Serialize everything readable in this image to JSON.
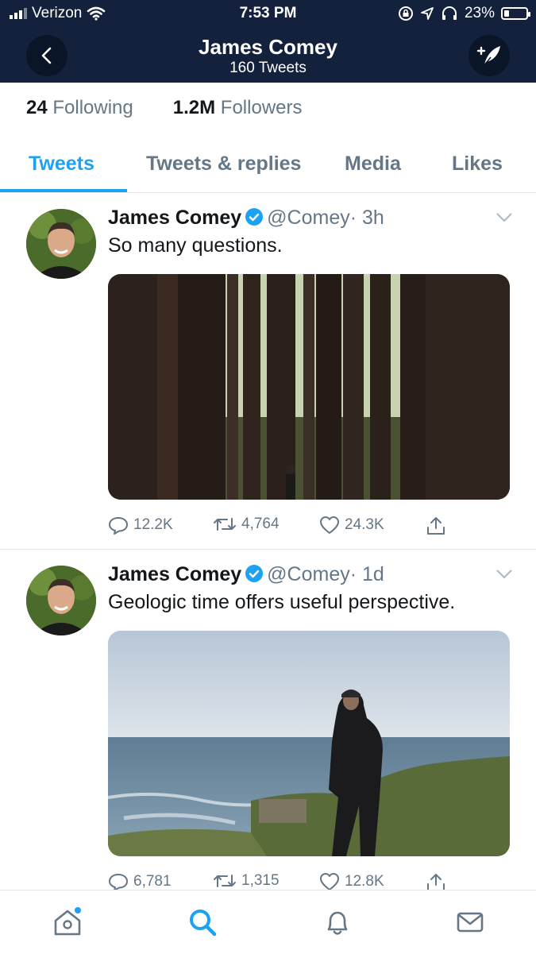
{
  "status_bar": {
    "carrier": "Verizon",
    "time": "7:53 PM",
    "battery": "23%",
    "battery_level": 0.23,
    "icons": [
      "signal-icon",
      "wifi-icon",
      "screen-lock-icon",
      "location-icon",
      "headphones-icon",
      "battery-icon"
    ]
  },
  "header": {
    "title": "James Comey",
    "subtitle": "160 Tweets",
    "back_icon": "chevron-left-icon",
    "compose_icon": "compose-tweet-icon"
  },
  "profile_stats": {
    "following_count": "24",
    "following_label": "Following",
    "followers_count": "1.2M",
    "followers_label": "Followers"
  },
  "tabs": [
    {
      "label": "Tweets",
      "active": true
    },
    {
      "label": "Tweets & replies",
      "active": false
    },
    {
      "label": "Media",
      "active": false
    },
    {
      "label": "Likes",
      "active": false
    }
  ],
  "tweets": [
    {
      "name": "James Comey",
      "handle": "@Comey",
      "time": "· 3h",
      "text": "So many questions.",
      "replies": "12.2K",
      "retweets": "4,764",
      "likes": "24.3K",
      "media": "photo of a man looking up among tall redwood trees"
    },
    {
      "name": "James Comey",
      "handle": "@Comey",
      "time": "· 1d",
      "text": "Geologic time offers useful perspective.",
      "replies": "6,781",
      "retweets": "1,315",
      "likes": "12.8K",
      "media": "photo of a man standing on a grassy cliff overlooking the ocean"
    }
  ],
  "bottom_nav": [
    {
      "icon": "home-icon",
      "active": false,
      "badge": true
    },
    {
      "icon": "search-icon",
      "active": true
    },
    {
      "icon": "notifications-icon",
      "active": false
    },
    {
      "icon": "messages-icon",
      "active": false
    }
  ],
  "colors": {
    "header_bg": "#14213d",
    "accent": "#1da1f2",
    "secondary_text": "#657786"
  }
}
